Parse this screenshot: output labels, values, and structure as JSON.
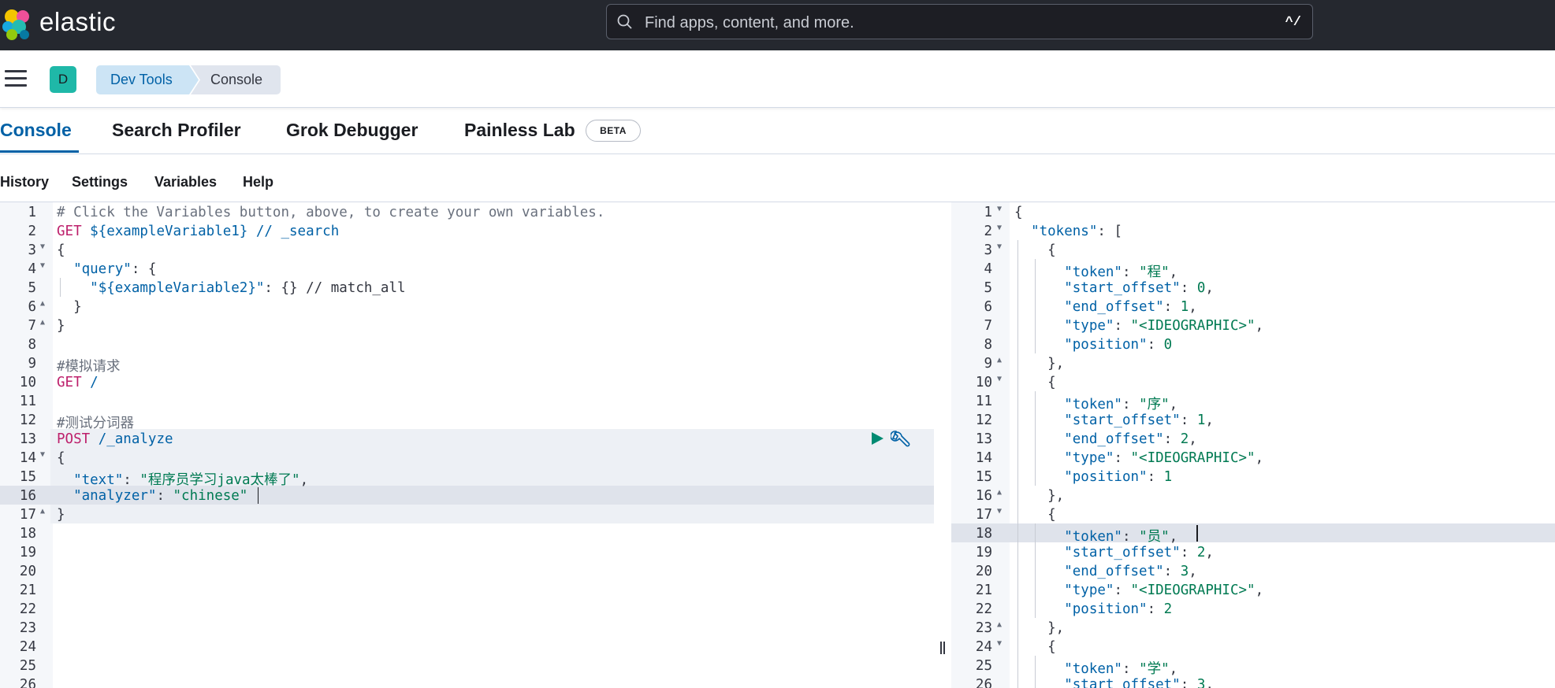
{
  "header": {
    "brand": "elastic",
    "search_placeholder": "Find apps, content, and more.",
    "search_shortcut": "^/"
  },
  "subheader": {
    "space_initial": "D",
    "breadcrumbs": [
      "Dev Tools",
      "Console"
    ]
  },
  "tabs": [
    {
      "label": "Console"
    },
    {
      "label": "Search Profiler"
    },
    {
      "label": "Grok Debugger"
    },
    {
      "label": "Painless Lab"
    }
  ],
  "beta_badge": "BETA",
  "console_nav": [
    "History",
    "Settings",
    "Variables",
    "Help"
  ],
  "request_editor": {
    "lines": [
      [
        [
          "c-comment",
          "# Click the Variables button, above, to create your own variables."
        ]
      ],
      [
        [
          "c-method",
          "GET"
        ],
        [
          "",
          " "
        ],
        [
          "c-url",
          "${exampleVariable1} // _search"
        ]
      ],
      [
        [
          "",
          "{"
        ]
      ],
      [
        [
          "",
          "  "
        ],
        [
          "c-key",
          "\"query\""
        ],
        [
          "",
          ": {"
        ]
      ],
      [
        [
          "",
          "    "
        ],
        [
          "c-key",
          "\"${exampleVariable2}\""
        ],
        [
          "",
          ": {} // match_all"
        ]
      ],
      [
        [
          "",
          "  }"
        ]
      ],
      [
        [
          "",
          "}"
        ]
      ],
      [
        [
          "",
          ""
        ]
      ],
      [
        [
          "c-comment",
          "#模拟请求"
        ]
      ],
      [
        [
          "c-method",
          "GET"
        ],
        [
          "",
          " "
        ],
        [
          "c-url",
          "/"
        ]
      ],
      [
        [
          "",
          ""
        ]
      ],
      [
        [
          "c-comment",
          "#测试分词器"
        ]
      ],
      [
        [
          "c-method",
          "POST"
        ],
        [
          "",
          " "
        ],
        [
          "c-url",
          "/_analyze"
        ]
      ],
      [
        [
          "",
          "{"
        ]
      ],
      [
        [
          "",
          "  "
        ],
        [
          "c-key",
          "\"text\""
        ],
        [
          "",
          ": "
        ],
        [
          "c-str",
          "\"程序员学习java太棒了\""
        ],
        [
          "",
          ","
        ]
      ],
      [
        [
          "",
          "  "
        ],
        [
          "c-key",
          "\"analyzer\""
        ],
        [
          "",
          ": "
        ],
        [
          "c-str",
          "\"chinese\""
        ]
      ],
      [
        [
          "",
          "}"
        ]
      ],
      [
        [
          "",
          ""
        ]
      ],
      [
        [
          "",
          ""
        ]
      ],
      [
        [
          "",
          ""
        ]
      ],
      [
        [
          "",
          ""
        ]
      ],
      [
        [
          "",
          ""
        ]
      ],
      [
        [
          "",
          ""
        ]
      ],
      [
        [
          "",
          ""
        ]
      ],
      [
        [
          "",
          ""
        ]
      ],
      [
        [
          "",
          ""
        ]
      ]
    ]
  },
  "response_editor": {
    "lines": [
      [
        [
          "",
          "{"
        ]
      ],
      [
        [
          "",
          "  "
        ],
        [
          "c-key",
          "\"tokens\""
        ],
        [
          "",
          ": ["
        ]
      ],
      [
        [
          "",
          "    {"
        ]
      ],
      [
        [
          "",
          "      "
        ],
        [
          "c-key",
          "\"token\""
        ],
        [
          "",
          ": "
        ],
        [
          "c-str",
          "\"程\""
        ],
        [
          "",
          ","
        ]
      ],
      [
        [
          "",
          "      "
        ],
        [
          "c-key",
          "\"start_offset\""
        ],
        [
          "",
          ": "
        ],
        [
          "c-num",
          "0"
        ],
        [
          "",
          ","
        ]
      ],
      [
        [
          "",
          "      "
        ],
        [
          "c-key",
          "\"end_offset\""
        ],
        [
          "",
          ": "
        ],
        [
          "c-num",
          "1"
        ],
        [
          "",
          ","
        ]
      ],
      [
        [
          "",
          "      "
        ],
        [
          "c-key",
          "\"type\""
        ],
        [
          "",
          ": "
        ],
        [
          "c-str",
          "\"<IDEOGRAPHIC>\""
        ],
        [
          "",
          ","
        ]
      ],
      [
        [
          "",
          "      "
        ],
        [
          "c-key",
          "\"position\""
        ],
        [
          "",
          ": "
        ],
        [
          "c-num",
          "0"
        ]
      ],
      [
        [
          "",
          "    },"
        ]
      ],
      [
        [
          "",
          "    {"
        ]
      ],
      [
        [
          "",
          "      "
        ],
        [
          "c-key",
          "\"token\""
        ],
        [
          "",
          ": "
        ],
        [
          "c-str",
          "\"序\""
        ],
        [
          "",
          ","
        ]
      ],
      [
        [
          "",
          "      "
        ],
        [
          "c-key",
          "\"start_offset\""
        ],
        [
          "",
          ": "
        ],
        [
          "c-num",
          "1"
        ],
        [
          "",
          ","
        ]
      ],
      [
        [
          "",
          "      "
        ],
        [
          "c-key",
          "\"end_offset\""
        ],
        [
          "",
          ": "
        ],
        [
          "c-num",
          "2"
        ],
        [
          "",
          ","
        ]
      ],
      [
        [
          "",
          "      "
        ],
        [
          "c-key",
          "\"type\""
        ],
        [
          "",
          ": "
        ],
        [
          "c-str",
          "\"<IDEOGRAPHIC>\""
        ],
        [
          "",
          ","
        ]
      ],
      [
        [
          "",
          "      "
        ],
        [
          "c-key",
          "\"position\""
        ],
        [
          "",
          ": "
        ],
        [
          "c-num",
          "1"
        ]
      ],
      [
        [
          "",
          "    },"
        ]
      ],
      [
        [
          "",
          "    {"
        ]
      ],
      [
        [
          "",
          "      "
        ],
        [
          "c-key",
          "\"token\""
        ],
        [
          "",
          ": "
        ],
        [
          "c-str",
          "\"员\""
        ],
        [
          "",
          ","
        ]
      ],
      [
        [
          "",
          "      "
        ],
        [
          "c-key",
          "\"start_offset\""
        ],
        [
          "",
          ": "
        ],
        [
          "c-num",
          "2"
        ],
        [
          "",
          ","
        ]
      ],
      [
        [
          "",
          "      "
        ],
        [
          "c-key",
          "\"end_offset\""
        ],
        [
          "",
          ": "
        ],
        [
          "c-num",
          "3"
        ],
        [
          "",
          ","
        ]
      ],
      [
        [
          "",
          "      "
        ],
        [
          "c-key",
          "\"type\""
        ],
        [
          "",
          ": "
        ],
        [
          "c-str",
          "\"<IDEOGRAPHIC>\""
        ],
        [
          "",
          ","
        ]
      ],
      [
        [
          "",
          "      "
        ],
        [
          "c-key",
          "\"position\""
        ],
        [
          "",
          ": "
        ],
        [
          "c-num",
          "2"
        ]
      ],
      [
        [
          "",
          "    },"
        ]
      ],
      [
        [
          "",
          "    {"
        ]
      ],
      [
        [
          "",
          "      "
        ],
        [
          "c-key",
          "\"token\""
        ],
        [
          "",
          ": "
        ],
        [
          "c-str",
          "\"学\""
        ],
        [
          "",
          ","
        ]
      ],
      [
        [
          "",
          "      "
        ],
        [
          "c-key",
          "\"start_offset\""
        ],
        [
          "",
          ": "
        ],
        [
          "c-num",
          "3"
        ],
        [
          "",
          ","
        ]
      ]
    ]
  },
  "colors": {
    "header_bg": "#25282f",
    "accent": "#0061a6",
    "space_avatar": "#1fb8a8",
    "method": "#bd1f6b",
    "string": "#007a52",
    "run_button": "#008a72"
  },
  "icons": {
    "search": "search-icon",
    "menu": "hamburger-menu-icon",
    "run": "play-icon",
    "wrench": "wrench-icon"
  }
}
